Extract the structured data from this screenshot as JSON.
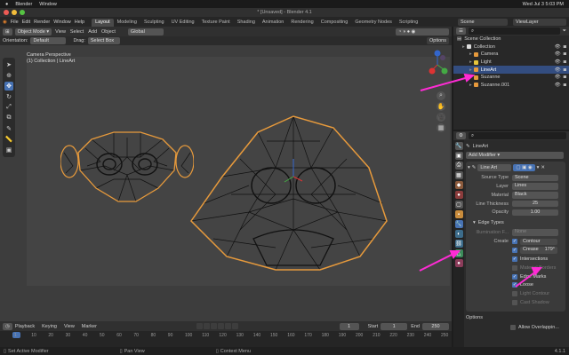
{
  "mac_menubar": {
    "app": "Blender",
    "window": "Window",
    "clock": "Wed Jul 3  5:03 PM"
  },
  "title": "* [Unsaved] - Blender 4.1",
  "topbar": {
    "menus": [
      "File",
      "Edit",
      "Render",
      "Window",
      "Help"
    ],
    "workspaces": [
      "Layout",
      "Modeling",
      "Sculpting",
      "UV Editing",
      "Texture Paint",
      "Shading",
      "Animation",
      "Rendering",
      "Compositing",
      "Geometry Nodes",
      "Scripting"
    ],
    "scene": "Scene",
    "view_layer": "ViewLayer"
  },
  "viewport": {
    "mode": "Object Mode",
    "menus": [
      "View",
      "Select",
      "Add",
      "Object"
    ],
    "orientation_label": "Orientation:",
    "orientation": "Default",
    "drag_label": "Drag:",
    "drag": "Select Box",
    "transform": "Global",
    "options": "Options",
    "info_line1": "Camera Perspective",
    "info_line2": "(1) Collection | LineArt"
  },
  "outliner": {
    "header": "Scene Collection",
    "items": [
      {
        "label": "Collection",
        "depth": 0,
        "color": "#dcdcdc",
        "selected": false
      },
      {
        "label": "Camera",
        "depth": 1,
        "color": "#e79a3c",
        "selected": false
      },
      {
        "label": "Light",
        "depth": 1,
        "color": "#e7c53c",
        "selected": false
      },
      {
        "label": "LineArt",
        "depth": 1,
        "color": "#e79a3c",
        "selected": true
      },
      {
        "label": "Suzanne",
        "depth": 1,
        "color": "#e79a3c",
        "selected": false
      },
      {
        "label": "Suzanne.001",
        "depth": 1,
        "color": "#e79a3c",
        "selected": false
      }
    ]
  },
  "properties": {
    "object_name": "LineArt",
    "add_modifier": "Add Modifier",
    "modifier_name": "Line Art",
    "fields": [
      {
        "label": "Source Type",
        "value": "Scene"
      },
      {
        "label": "Layer",
        "value": "Lines"
      },
      {
        "label": "Material",
        "value": "Black"
      },
      {
        "label": "Line Thickness",
        "value": "25"
      },
      {
        "label": "Opacity",
        "value": "1.00"
      }
    ],
    "edge_types_header": "Edge Types",
    "illumination_label": "Illumination F...",
    "illumination_value": "None",
    "create_label": "Create",
    "contour": "Contour",
    "crease_label": "Crease",
    "crease_value": "179°",
    "checks": [
      {
        "label": "Intersections",
        "on": true
      },
      {
        "label": "Material Borders",
        "on": false
      },
      {
        "label": "Edge Marks",
        "on": true
      },
      {
        "label": "Loose",
        "on": true
      },
      {
        "label": "Light Contour",
        "on": false
      },
      {
        "label": "Cast Shadow",
        "on": false
      }
    ],
    "options_header": "Options",
    "allow_overlap": "Allow Overlappin..."
  },
  "timeline": {
    "menus": [
      "Playback",
      "Keying",
      "View",
      "Marker"
    ],
    "current_frame": "1",
    "start_label": "Start",
    "start": "1",
    "end_label": "End",
    "end": "250",
    "ticks": [
      "1",
      "10",
      "20",
      "30",
      "40",
      "50",
      "60",
      "70",
      "80",
      "90",
      "100",
      "110",
      "120",
      "130",
      "140",
      "150",
      "160",
      "170",
      "180",
      "190",
      "200",
      "210",
      "220",
      "230",
      "240",
      "250"
    ]
  },
  "statusbar": {
    "left": "Set Active Modifier",
    "middle": "Pan View",
    "right": "Context Menu",
    "version": "4.1.1"
  },
  "colors": {
    "accent": "#4772b3",
    "selection": "#e79a3c",
    "annotation": "#ff2bd5",
    "viewport_bg": "#3d3d3d"
  }
}
